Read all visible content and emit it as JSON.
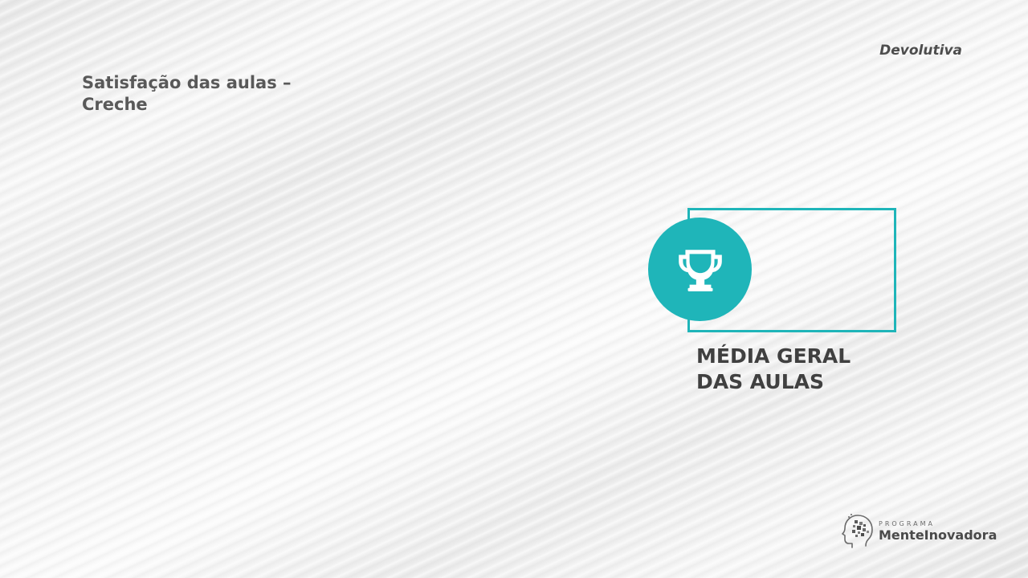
{
  "header": {
    "section_label": "Devolutiva"
  },
  "title": {
    "line1": "Satisfação das aulas –",
    "line2": "Creche"
  },
  "kpi": {
    "label_line1": "MÉDIA GERAL",
    "label_line2": "DAS AULAS",
    "icon": "trophy-icon",
    "accent_color": "#1fb5b9"
  },
  "logo": {
    "small_text": "PROGRAMA",
    "big_text": "MenteInovadora",
    "icon": "head-gears-icon"
  }
}
